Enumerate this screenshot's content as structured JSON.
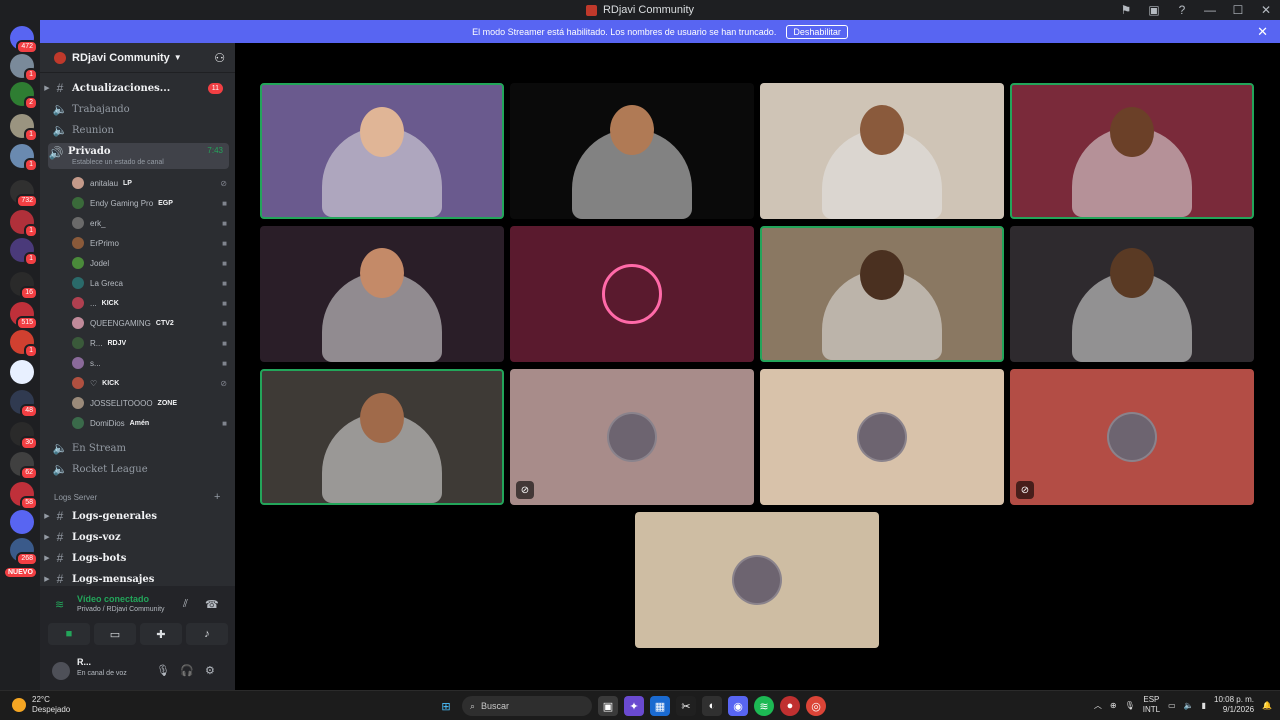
{
  "window": {
    "title": "RDjavi Community",
    "controls": [
      "⚑",
      "▣",
      "?",
      "—",
      "☐",
      "✕"
    ]
  },
  "banner": {
    "text": "El modo Streamer está habilitado. Los nombres de usuario se han truncado.",
    "button": "Deshabilitar",
    "close": "✕"
  },
  "servers": {
    "badges": [
      "472",
      "1",
      "2",
      "1",
      "1",
      "1",
      "732",
      "1",
      "1",
      "16",
      "515",
      "1",
      "48",
      "30",
      "62",
      "58",
      "268"
    ],
    "new_label": "NUEVO"
  },
  "guild": {
    "name": "RDjavi Community"
  },
  "channels": {
    "actualizaciones": {
      "name": "Actualizaciones...",
      "badge": "11"
    },
    "trabajando": {
      "name": "Trabajando"
    },
    "reunion": {
      "name": "Reunion"
    },
    "privado": {
      "name": "Privado",
      "time": "7:43",
      "status": "Establece un estado de canal"
    },
    "en_stream": {
      "name": "En Stream"
    },
    "rocket": {
      "name": "Rocket League"
    }
  },
  "voice_users": [
    {
      "name": "anitalau",
      "tag": "LP"
    },
    {
      "name": "Endy Gaming Pro",
      "tag": "EGP"
    },
    {
      "name": "erk_",
      "tag": ""
    },
    {
      "name": "ErPrimo",
      "tag": ""
    },
    {
      "name": "Jodel",
      "tag": ""
    },
    {
      "name": "La Greca",
      "tag": ""
    },
    {
      "name": "...",
      "tag": "KICK"
    },
    {
      "name": "QUEENGAMING",
      "tag": "CTV2"
    },
    {
      "name": "R...",
      "tag": "RDJV"
    },
    {
      "name": "s...",
      "tag": ""
    },
    {
      "name": "♡",
      "tag": "KICK"
    },
    {
      "name": "JOSSELITOOOO",
      "tag": "ZONE"
    },
    {
      "name": "DomiDios",
      "tag": "Amén"
    }
  ],
  "logs_category": {
    "name": "Logs Server",
    "channels": [
      "Logs-generales",
      "Logs-voz",
      "Logs-bots",
      "Logs-mensajes"
    ]
  },
  "voice_panel": {
    "status": "Vídeo conectado",
    "location": "Privado / RDjavi Community"
  },
  "user_panel": {
    "name": "R...",
    "status": "En canal de voz"
  },
  "tiles": [
    {
      "speaking": true,
      "bg": "#6a5a8e",
      "skin": "#e0b596",
      "muted": false
    },
    {
      "speaking": false,
      "bg": "#0a0a0a",
      "skin": "#b07a55",
      "muted": false
    },
    {
      "speaking": false,
      "bg": "#cfc4b6",
      "skin": "#8a5a3c",
      "muted": false
    },
    {
      "speaking": true,
      "bg": "#7a2a3a",
      "skin": "#6b4028",
      "muted": false
    },
    {
      "speaking": false,
      "bg": "#2a1e28",
      "skin": "#c48a68",
      "muted": false
    },
    {
      "speaking": false,
      "bg": "#5a1a2e",
      "skin": "",
      "muted": false
    },
    {
      "speaking": true,
      "bg": "#8a7862",
      "skin": "#4a3020",
      "muted": false
    },
    {
      "speaking": false,
      "bg": "#2e2a2e",
      "skin": "#5a3a24",
      "muted": false
    },
    {
      "speaking": true,
      "bg": "#3e3a36",
      "skin": "#a06a4a",
      "muted": false
    },
    {
      "speaking": false,
      "bg": "#a88c8a",
      "skin": "",
      "muted": true
    },
    {
      "speaking": false,
      "bg": "#d8c2aa",
      "skin": "",
      "muted": false
    },
    {
      "speaking": false,
      "bg": "#b34d45",
      "skin": "",
      "muted": true
    },
    {
      "speaking": false,
      "bg": "#cebda3",
      "skin": "",
      "muted": false
    }
  ],
  "taskbar": {
    "temp": "22°C",
    "weather": "Despejado",
    "search_placeholder": "Buscar",
    "lang1": "ESP",
    "lang2": "INTL",
    "time": "10:08 p. m.",
    "date": "9/1/2026"
  }
}
